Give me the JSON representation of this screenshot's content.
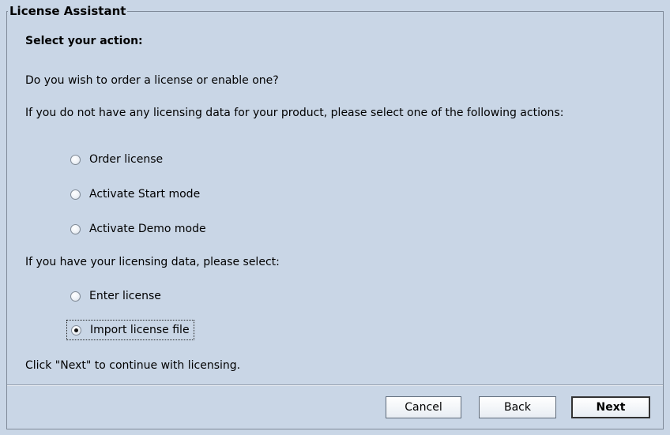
{
  "window": {
    "group_title": "License Assistant"
  },
  "content": {
    "heading": "Select your action:",
    "question": "Do you wish to order a license or enable one?",
    "no_data_prompt": "If you do not have any licensing data for your product, please select one of the following actions:",
    "have_data_prompt": "If you have your licensing data, please select:",
    "footer_hint": "Click \"Next\" to continue with licensing."
  },
  "options": {
    "order_license": {
      "label": "Order license",
      "checked": false
    },
    "activate_start": {
      "label": "Activate Start mode",
      "checked": false
    },
    "activate_demo": {
      "label": "Activate Demo mode",
      "checked": false
    },
    "enter_license": {
      "label": "Enter license",
      "checked": false
    },
    "import_license_file": {
      "label": "Import license file",
      "checked": true
    }
  },
  "buttons": {
    "cancel": "Cancel",
    "back": "Back",
    "next": "Next"
  }
}
